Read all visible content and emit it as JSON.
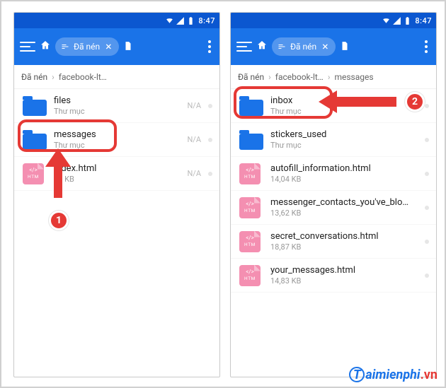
{
  "status": {
    "time": "8:47"
  },
  "toolbar": {
    "pill_label": "Đã nén"
  },
  "left": {
    "crumbs": [
      "Đã nén",
      "facebook-lt…"
    ],
    "rows": [
      {
        "name": "files",
        "sub": "Thư mục",
        "meta": "N/A",
        "type": "folder"
      },
      {
        "name": "messages",
        "sub": "Thư mục",
        "meta": "N/A",
        "type": "folder"
      },
      {
        "name": "index.html",
        "sub": "60 KB",
        "meta": "N/A",
        "type": "htm"
      }
    ]
  },
  "right": {
    "crumbs": [
      "Đã nén",
      "facebook-lt…",
      "messages"
    ],
    "rows": [
      {
        "name": "inbox",
        "sub": "Thư mục",
        "meta": "",
        "type": "folder"
      },
      {
        "name": "stickers_used",
        "sub": "Thư mục",
        "meta": "",
        "type": "folder"
      },
      {
        "name": "autofill_information.html",
        "sub": "14,04 KB",
        "meta": "",
        "type": "htm"
      },
      {
        "name": "messenger_contacts_you've_blo…",
        "sub": "13,62 KB",
        "meta": "",
        "type": "htm"
      },
      {
        "name": "secret_conversations.html",
        "sub": "18,87 KB",
        "meta": "",
        "type": "htm"
      },
      {
        "name": "your_messages.html",
        "sub": "14,83 KB",
        "meta": "",
        "type": "htm"
      }
    ]
  },
  "annot": {
    "step1": "1",
    "step2": "2"
  },
  "watermark": {
    "text": "aimienphi",
    "suffix": ".vn",
    "cap": "T"
  }
}
